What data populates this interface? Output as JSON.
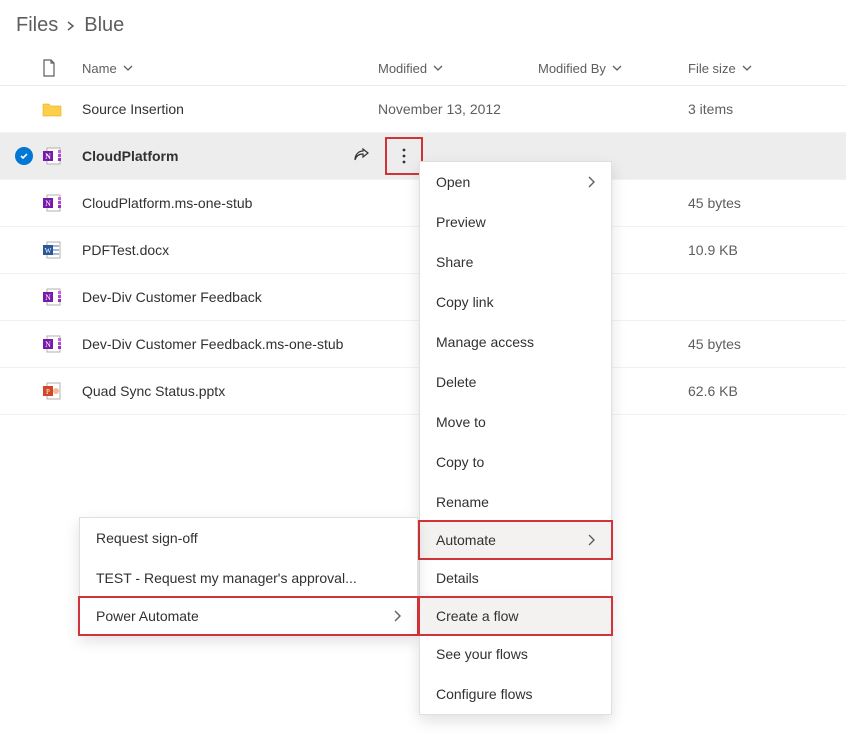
{
  "breadcrumb": {
    "root": "Files",
    "current": "Blue"
  },
  "columns": {
    "name": "Name",
    "modified": "Modified",
    "modified_by": "Modified By",
    "file_size": "File size"
  },
  "rows": [
    {
      "name": "Source Insertion",
      "modified": "November 13, 2012",
      "size": "3 items",
      "icon": "folder",
      "selected": false
    },
    {
      "name": "CloudPlatform",
      "modified": "",
      "size": "",
      "icon": "onenote",
      "selected": true
    },
    {
      "name": "CloudPlatform.ms-one-stub",
      "modified": "",
      "size": "45 bytes",
      "icon": "onenote",
      "selected": false
    },
    {
      "name": "PDFTest.docx",
      "modified": "",
      "size": "10.9 KB",
      "icon": "word",
      "selected": false
    },
    {
      "name": "Dev-Div Customer Feedback",
      "modified": "",
      "size": "",
      "icon": "onenote",
      "selected": false
    },
    {
      "name": "Dev-Div Customer Feedback.ms-one-stub",
      "modified": "",
      "size": "45 bytes",
      "icon": "onenote",
      "selected": false
    },
    {
      "name": "Quad Sync Status.pptx",
      "modified": "",
      "size": "62.6 KB",
      "icon": "powerpoint",
      "selected": false
    }
  ],
  "context_menu": {
    "items": [
      {
        "label": "Open",
        "submenu": true
      },
      {
        "label": "Preview"
      },
      {
        "label": "Share"
      },
      {
        "label": "Copy link"
      },
      {
        "label": "Manage access"
      },
      {
        "label": "Delete"
      },
      {
        "label": "Move to"
      },
      {
        "label": "Copy to"
      },
      {
        "label": "Rename"
      },
      {
        "label": "Automate",
        "submenu": true,
        "hover": true,
        "highlight": true
      },
      {
        "label": "Details"
      }
    ]
  },
  "automate_submenu_top": {
    "items": [
      {
        "label": "Request sign-off"
      },
      {
        "label": "TEST - Request my manager's approval..."
      },
      {
        "label": "Power Automate",
        "submenu": true,
        "highlight": true
      }
    ]
  },
  "automate_submenu_right": {
    "items": [
      {
        "label": "Create a flow",
        "hover": true,
        "highlight": true
      },
      {
        "label": "See your flows"
      },
      {
        "label": "Configure flows"
      }
    ]
  }
}
